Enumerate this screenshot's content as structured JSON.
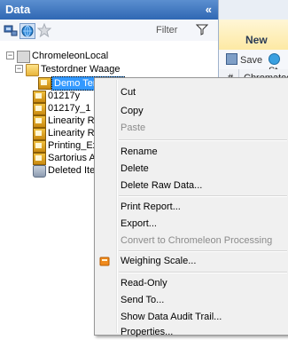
{
  "panel": {
    "title": "Data",
    "collapse_glyph": "«"
  },
  "toolbar": {
    "filter_label": "Filter",
    "icons": [
      "network-icon",
      "globe-icon",
      "star-icon",
      "filter-icon"
    ]
  },
  "right": {
    "header": "New",
    "save_label": "Save",
    "start_label": "St",
    "col_hash": "#",
    "col_name": "Chromatog"
  },
  "tree": {
    "root": "ChromeleonLocal",
    "folder": "Testordner Waage",
    "items": [
      {
        "label": "Demo Template",
        "selected": true
      },
      {
        "label": "01217y"
      },
      {
        "label": "01217y_1"
      },
      {
        "label": "Linearity Run"
      },
      {
        "label": "Linearity Run"
      },
      {
        "label": "Printing_Expe"
      },
      {
        "label": "Sartorius Aus"
      },
      {
        "label": "Deleted Item"
      }
    ]
  },
  "context_menu": {
    "items": [
      {
        "label": "Cut"
      },
      {
        "label": "Copy"
      },
      {
        "label": "Paste",
        "disabled": true
      },
      {
        "label": "Rename"
      },
      {
        "label": "Delete"
      },
      {
        "label": "Delete Raw Data..."
      },
      {
        "label": "Print Report..."
      },
      {
        "label": "Export..."
      },
      {
        "label": "Convert to Chromeleon Processing",
        "disabled": true
      },
      {
        "label": "Weighing Scale...",
        "icon": "weighing-scale-icon"
      },
      {
        "label": "Read-Only"
      },
      {
        "label": "Send To..."
      },
      {
        "label": "Show Data Audit Trail..."
      },
      {
        "label": "Properties..."
      }
    ]
  },
  "colors": {
    "header_blue": "#2f67b3",
    "selection": "#3399ff",
    "new_header": "#fde9a4"
  }
}
